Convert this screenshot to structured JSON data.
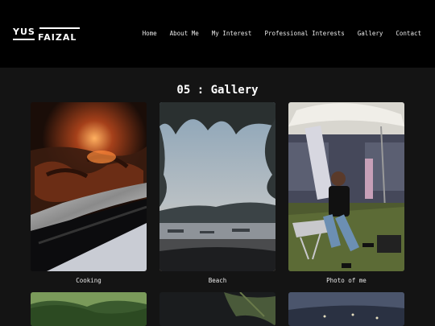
{
  "brand": {
    "line1": "YUS",
    "line2": "FAIZAL"
  },
  "nav": [
    "Home",
    "About Me",
    "My Interest",
    "Professional Interests",
    "Gallery",
    "Contact"
  ],
  "section_title": "05 : Gallery",
  "gallery": [
    {
      "caption": "Cooking"
    },
    {
      "caption": "Beach"
    },
    {
      "caption": "Photo of me"
    }
  ]
}
